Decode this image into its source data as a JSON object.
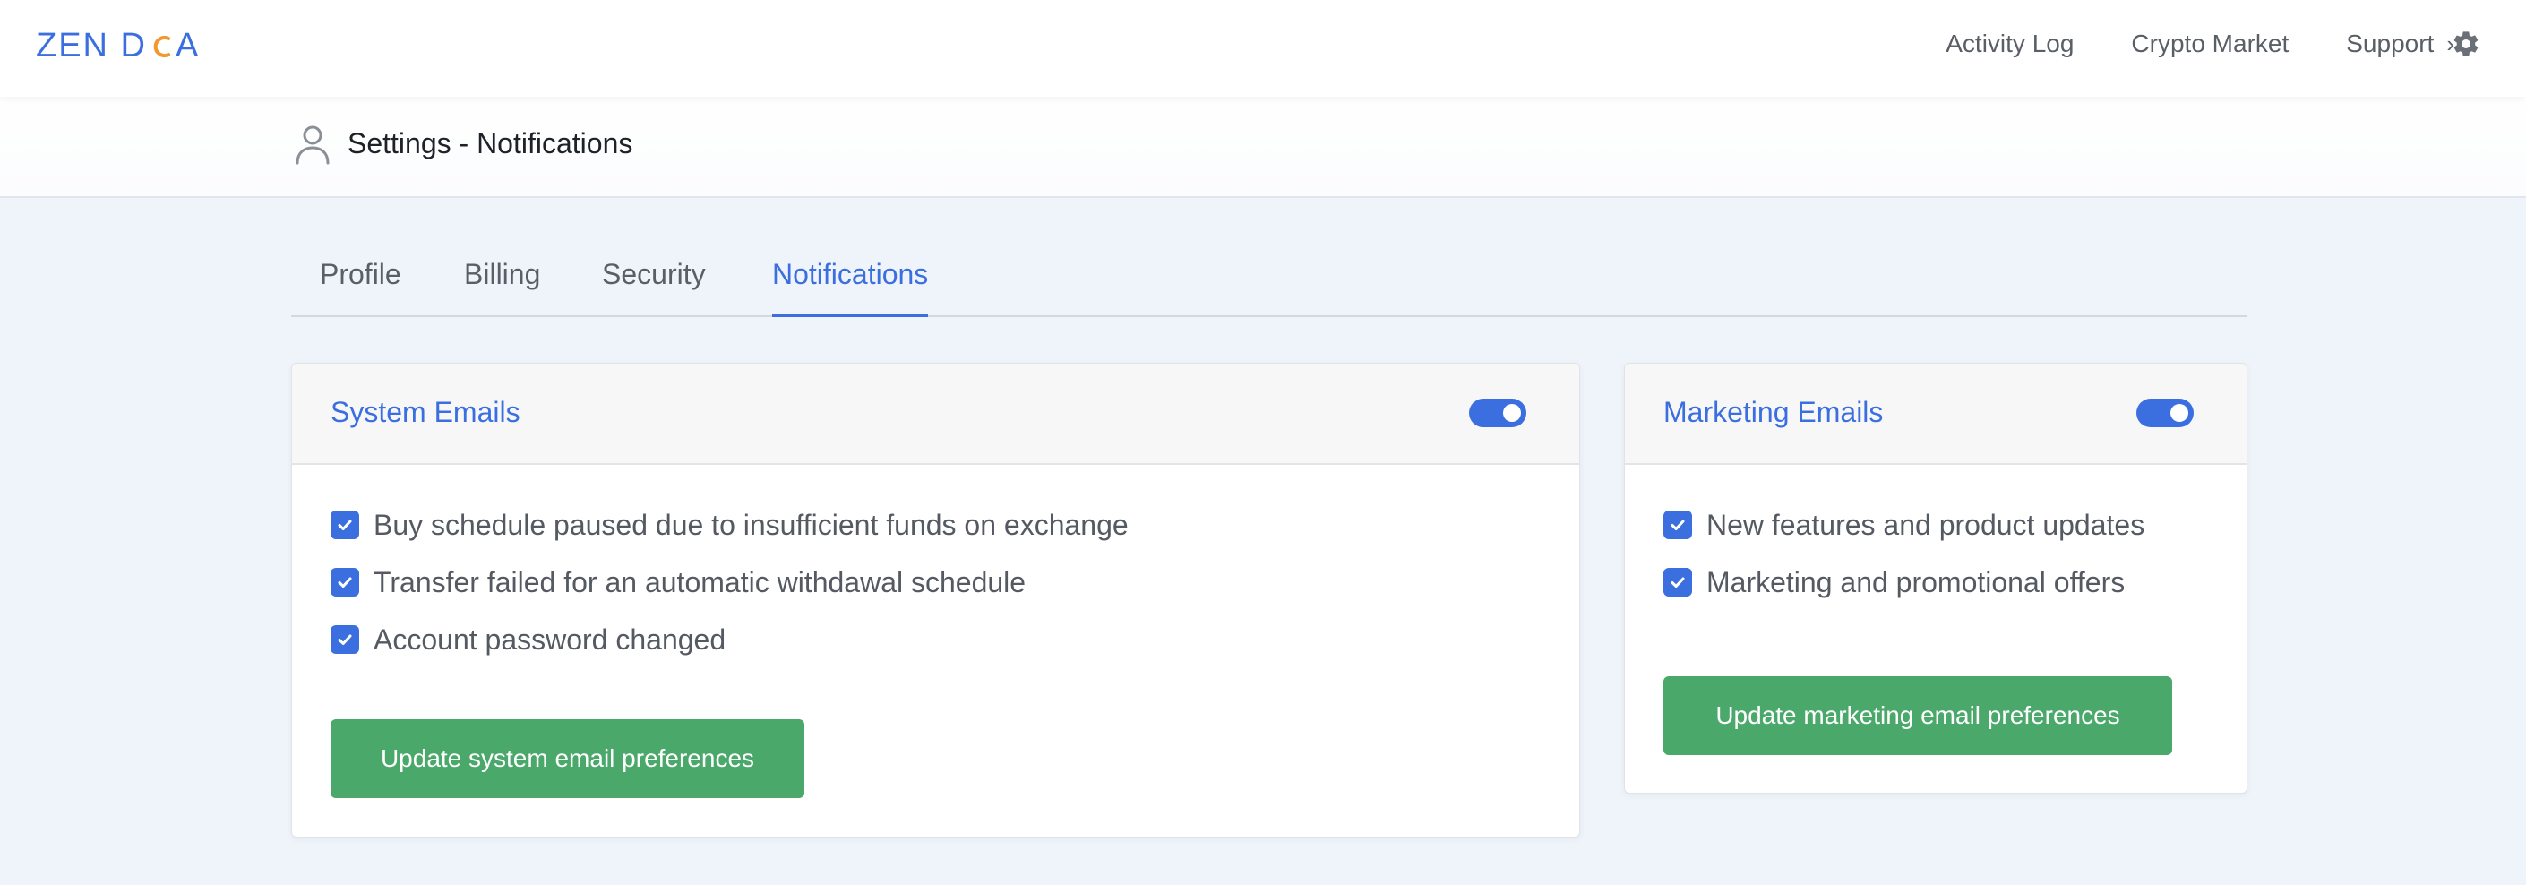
{
  "app": {
    "logo_text": "ZEN DCA",
    "logo_parts": {
      "before": "ZEN D",
      "after": "A"
    },
    "accent_color": "#3b6fe0",
    "logo_c_color": "#f2992e"
  },
  "nav": {
    "links": [
      {
        "label": "Activity Log"
      },
      {
        "label": "Crypto Market"
      },
      {
        "label": "Support",
        "chevron": "›"
      }
    ],
    "settings_icon": "gear-icon"
  },
  "header": {
    "icon": "user-icon",
    "title": "Settings - Notifications"
  },
  "tabs": [
    {
      "label": "Profile",
      "active": false
    },
    {
      "label": "Billing",
      "active": false
    },
    {
      "label": "Security",
      "active": false
    },
    {
      "label": "Notifications",
      "active": true
    }
  ],
  "system_emails": {
    "title": "System Emails",
    "enabled": true,
    "options": [
      {
        "label": "Buy schedule paused due to insufficient funds on exchange",
        "checked": true
      },
      {
        "label": "Transfer failed for an automatic withdawal schedule",
        "checked": true
      },
      {
        "label": "Account password changed",
        "checked": true
      }
    ],
    "button_label": "Update system email preferences",
    "button_color": "#4aa86a"
  },
  "marketing_emails": {
    "title": "Marketing Emails",
    "enabled": true,
    "options": [
      {
        "label": "New features and product updates",
        "checked": true
      },
      {
        "label": "Marketing and promotional offers",
        "checked": true
      }
    ],
    "button_label": "Update marketing email preferences",
    "button_color": "#4aa86a"
  }
}
